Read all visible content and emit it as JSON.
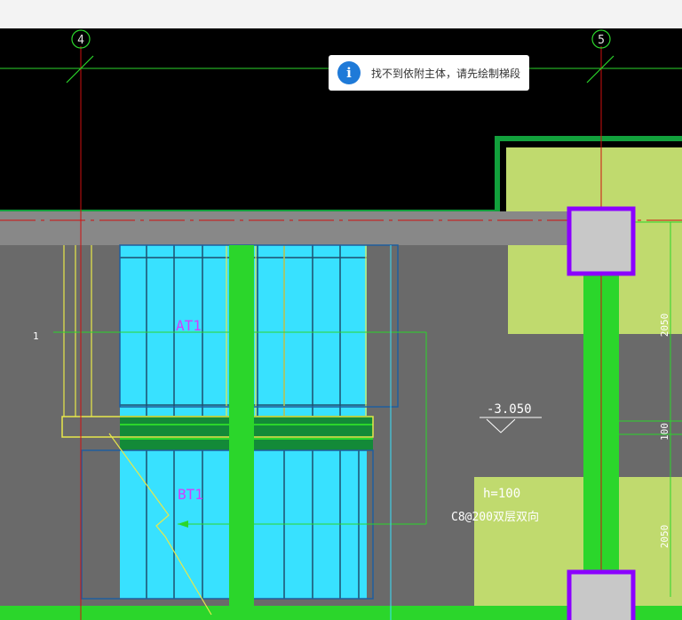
{
  "toast": {
    "icon": "info-icon",
    "message": "找不到依附主体，请先绘制梯段"
  },
  "drawing": {
    "axis_labels": [
      "4",
      "5"
    ],
    "stair_labels": [
      "AT1",
      "BT1"
    ],
    "elevation": "-3.050",
    "slab_thickness": "h=100",
    "rebar_note": "C8@200双层双向",
    "dimensions": [
      "2050",
      "100",
      "2050"
    ],
    "side_mark": "1"
  },
  "colors": {
    "background": "#000000",
    "wall_gray": "#6a6a6a",
    "beam_gray": "#888888",
    "stair_cyan": "#38e1ff",
    "slab_green": "#2bd62b",
    "landing_green": "#138a38",
    "pad_lime": "#c0da6e",
    "column_purple": "#8b00ff",
    "column_fill": "#c8c8c8",
    "label_magenta": "#d23cff",
    "axis_red": "#d01010",
    "info_blue": "#1f7ad8"
  }
}
